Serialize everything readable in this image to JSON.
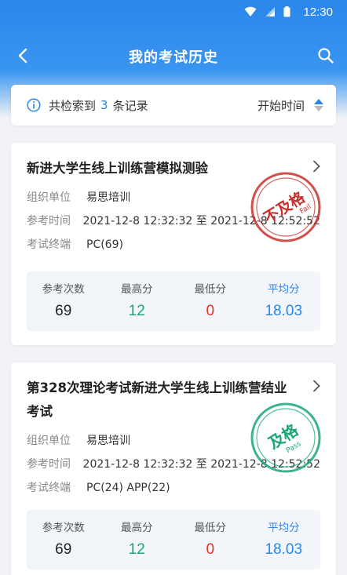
{
  "status_bar": {
    "time": "12:30"
  },
  "nav": {
    "title": "我的考试历史"
  },
  "summary": {
    "prefix": "共检索到",
    "count": "3",
    "suffix": "条记录",
    "sort_label": "开始时间"
  },
  "records": [
    {
      "title": "新进大学生线上训练营模拟测验",
      "org_label": "组织单位",
      "org": "易思培训",
      "time_label": "参考时间",
      "time": "2021-12-8 12:32:32 至 2021-12-8 12:52:52",
      "terminal_label": "考试终端",
      "terminal": "PC(69)",
      "stamp": {
        "text": "不及格",
        "sub": "Fail",
        "color": "#c9302c"
      },
      "stats": [
        {
          "label": "参考次数",
          "value": "69"
        },
        {
          "label": "最高分",
          "value": "12"
        },
        {
          "label": "最低分",
          "value": "0"
        },
        {
          "label": "平均分",
          "value": "18.03"
        }
      ]
    },
    {
      "title": "第328次理论考试新进大学生线上训练营结业考试",
      "title_line1": "第328次理论考试新进大学生线上训练营结业",
      "title_line2": "考试",
      "org_label": "组织单位",
      "org": "易思培训",
      "time_label": "参考时间",
      "time": "2021-12-8 12:32:32 至 2021-12-8 12:52:52",
      "terminal_label": "考试终端",
      "terminal": "PC(24)  APP(22)",
      "stamp": {
        "text": "及格",
        "sub": "Pass",
        "color": "#1aa774"
      },
      "stats": [
        {
          "label": "参考次数",
          "value": "69"
        },
        {
          "label": "最高分",
          "value": "12"
        },
        {
          "label": "最低分",
          "value": "0"
        },
        {
          "label": "平均分",
          "value": "18.03"
        }
      ]
    }
  ],
  "colors": {
    "primary": "#2b86ec",
    "green": "#1aa774",
    "red": "#e5332a"
  }
}
